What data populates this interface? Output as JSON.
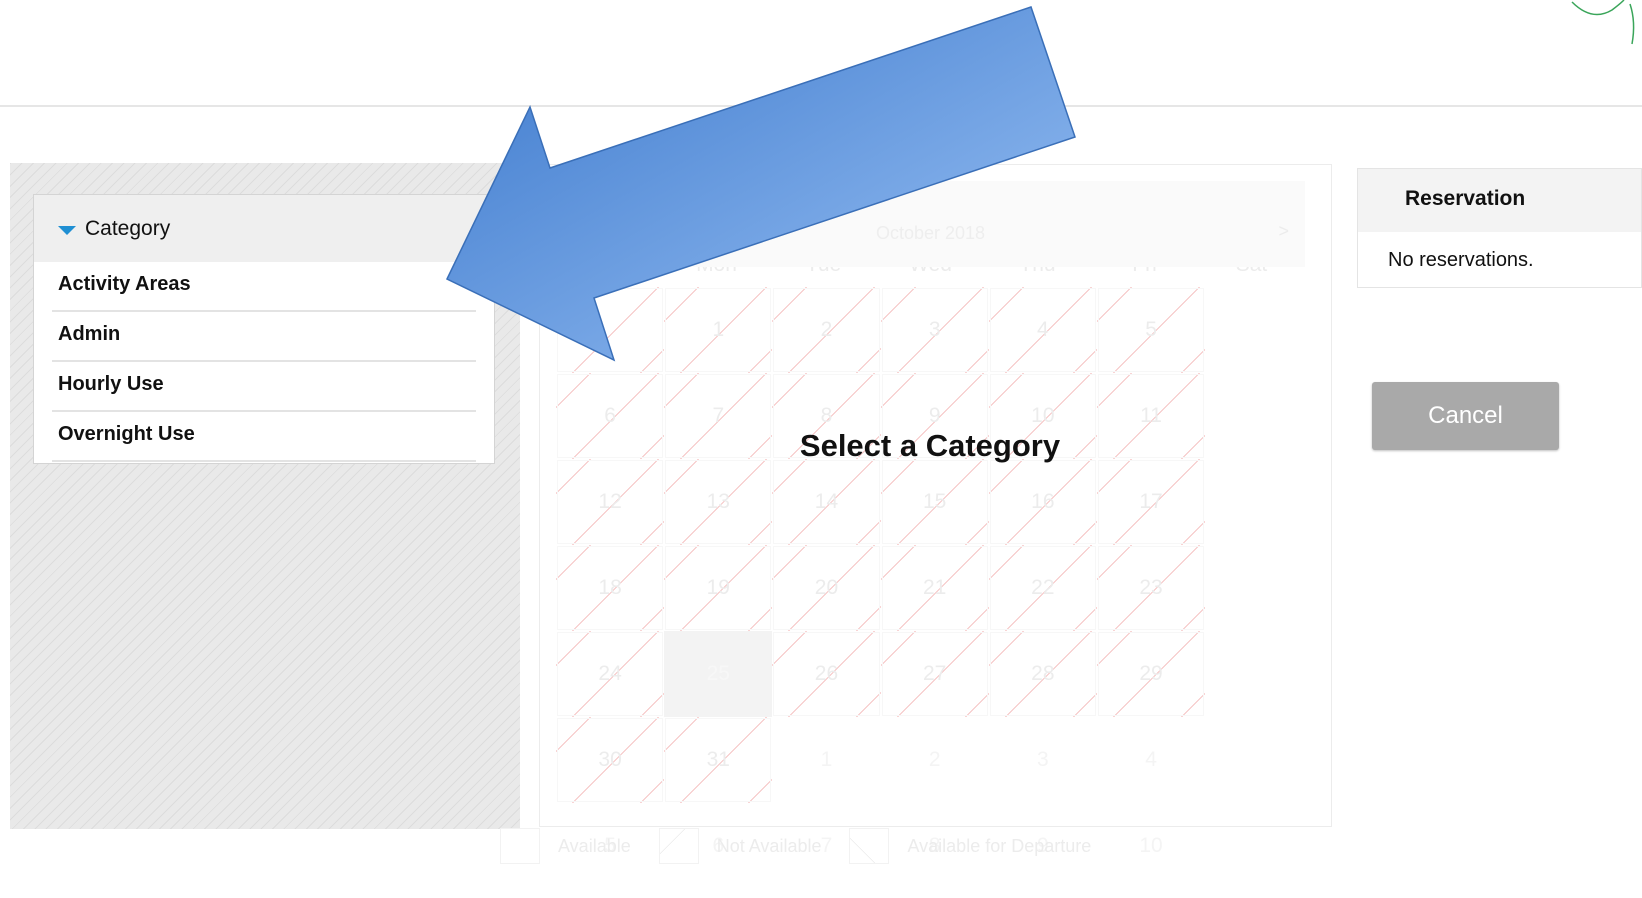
{
  "category_panel": {
    "header": "Category",
    "items": [
      "Activity Areas",
      "Admin",
      "Hourly Use",
      "Overnight Use"
    ]
  },
  "calendar": {
    "month_title": "October 2018",
    "next_label": ">",
    "weekdays": [
      "Sun",
      "Mon",
      "Tue",
      "Wed",
      "Thu",
      "Fri",
      "Sat"
    ],
    "weeks": [
      [
        {
          "d": "",
          "s": "na"
        },
        {
          "d": "1",
          "s": "na"
        },
        {
          "d": "2",
          "s": "na"
        },
        {
          "d": "3",
          "s": "na"
        },
        {
          "d": "4",
          "s": "na"
        },
        {
          "d": "5",
          "s": "na"
        },
        {
          "d": "6",
          "s": "na"
        }
      ],
      [
        {
          "d": "7",
          "s": "na"
        },
        {
          "d": "8",
          "s": "na"
        },
        {
          "d": "9",
          "s": "na"
        },
        {
          "d": "10",
          "s": "na"
        },
        {
          "d": "11",
          "s": "na"
        },
        {
          "d": "12",
          "s": "na"
        },
        {
          "d": "13",
          "s": "na"
        }
      ],
      [
        {
          "d": "14",
          "s": "na"
        },
        {
          "d": "15",
          "s": "na"
        },
        {
          "d": "16",
          "s": "na"
        },
        {
          "d": "17",
          "s": "na"
        },
        {
          "d": "18",
          "s": "na"
        },
        {
          "d": "19",
          "s": "na"
        },
        {
          "d": "20",
          "s": "na"
        }
      ],
      [
        {
          "d": "21",
          "s": "na"
        },
        {
          "d": "22",
          "s": "na"
        },
        {
          "d": "23",
          "s": "na"
        },
        {
          "d": "24",
          "s": "na"
        },
        {
          "d": "25",
          "s": "today"
        },
        {
          "d": "26",
          "s": "na"
        },
        {
          "d": "27",
          "s": "na"
        }
      ],
      [
        {
          "d": "28",
          "s": "na"
        },
        {
          "d": "29",
          "s": "na"
        },
        {
          "d": "30",
          "s": "na"
        },
        {
          "d": "31",
          "s": "na"
        },
        {
          "d": "1",
          "s": "other"
        },
        {
          "d": "2",
          "s": "other"
        },
        {
          "d": "3",
          "s": "other"
        }
      ],
      [
        {
          "d": "4",
          "s": "other"
        },
        {
          "d": "5",
          "s": "other"
        },
        {
          "d": "6",
          "s": "other"
        },
        {
          "d": "7",
          "s": "other"
        },
        {
          "d": "8",
          "s": "other"
        },
        {
          "d": "9",
          "s": "other"
        },
        {
          "d": "10",
          "s": "other"
        }
      ]
    ],
    "overlay_message": "Select a Category",
    "legend": [
      "Available",
      "Not Available",
      "Available for Departure"
    ]
  },
  "reservation": {
    "title": "Reservation",
    "empty_text": "No reservations."
  },
  "actions": {
    "cancel_label": "Cancel"
  },
  "colors": {
    "accent_triangle": "#1f8fd3",
    "arrow_fill_dark": "#3b78cc",
    "arrow_fill_light": "#9cc3f5",
    "cancel_button": "#a9a9a9"
  },
  "icons": {
    "category_toggle": "triangle-down-icon",
    "pointer_arrow": "big-arrow-annotation",
    "logo": "leaf-logo"
  }
}
